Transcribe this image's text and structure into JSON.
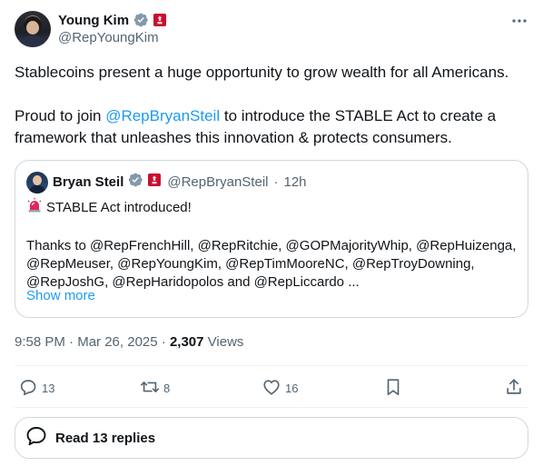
{
  "author": {
    "name": "Young Kim",
    "handle": "@RepYoungKim",
    "verified_color": "#829aab",
    "flag_color": "#c8102e"
  },
  "tweet": {
    "paragraph1": "Stablecoins present a huge opportunity to grow wealth for all Americans.",
    "paragraph2_pre": "Proud to join ",
    "paragraph2_mention": "@RepBryanSteil",
    "paragraph2_post": " to introduce the STABLE Act to create a framework that unleashes this innovation & protects consumers."
  },
  "quote": {
    "name": "Bryan Steil",
    "handle": "@RepBryanSteil",
    "separator": "·",
    "time": "12h",
    "line1": "STABLE Act introduced!",
    "thanks": "Thanks to @RepFrenchHill, @RepRitchie, @GOPMajorityWhip, @RepHuizenga, @RepMeuser, @RepYoungKim, @RepTimMooreNC, @RepTroyDowning, @RepJoshG, @RepHaridopolos and @RepLiccardo ...",
    "show_more": "Show more"
  },
  "meta": {
    "time": "9:58 PM",
    "date": "Mar 26, 2025",
    "separator": "·",
    "views_count": "2,307",
    "views_label": "Views"
  },
  "actions": {
    "replies": "13",
    "reposts": "8",
    "likes": "16"
  },
  "read_replies": {
    "label": "Read 13 replies"
  },
  "colors": {
    "accent": "#1d9bf0",
    "secondary_text": "#536471",
    "border": "#cfd9de"
  }
}
